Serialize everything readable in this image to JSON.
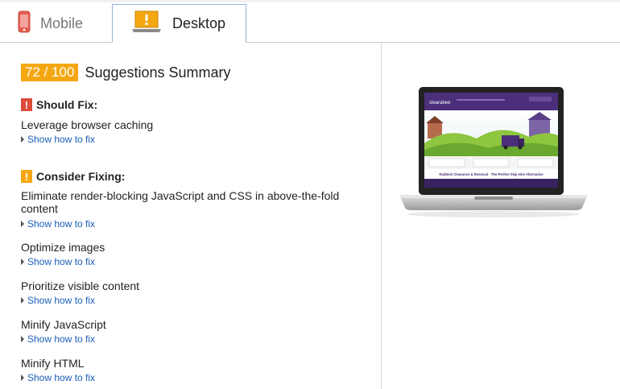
{
  "tabs": {
    "mobile_label": "Mobile",
    "desktop_label": "Desktop"
  },
  "summary": {
    "score": "72 / 100",
    "title": "Suggestions Summary"
  },
  "should_fix": {
    "heading": "Should Fix:",
    "items": [
      {
        "title": "Leverage browser caching",
        "link": "Show how to fix"
      }
    ]
  },
  "consider_fixing": {
    "heading": "Consider Fixing:",
    "items": [
      {
        "title_line1": "Eliminate render-blocking JavaScript and CSS in above-the-fold",
        "title_line2": "content",
        "link": "Show how to fix"
      },
      {
        "title": "Optimize images",
        "link": "Show how to fix"
      },
      {
        "title": "Prioritize visible content",
        "link": "Show how to fix"
      },
      {
        "title": "Minify JavaScript",
        "link": "Show how to fix"
      },
      {
        "title": "Minify HTML",
        "link": "Show how to fix"
      }
    ]
  },
  "preview": {
    "site_name": "clearabee",
    "banner_text": "Rubbish Clearance & Removal - The Perfect Skip Hire Alternative"
  },
  "colors": {
    "score": "#f5a712",
    "should_fix_badge": "#dd4b39",
    "consider_badge": "#f5a712",
    "link": "#1a5eb8",
    "site_purple": "#4b2f7a"
  }
}
